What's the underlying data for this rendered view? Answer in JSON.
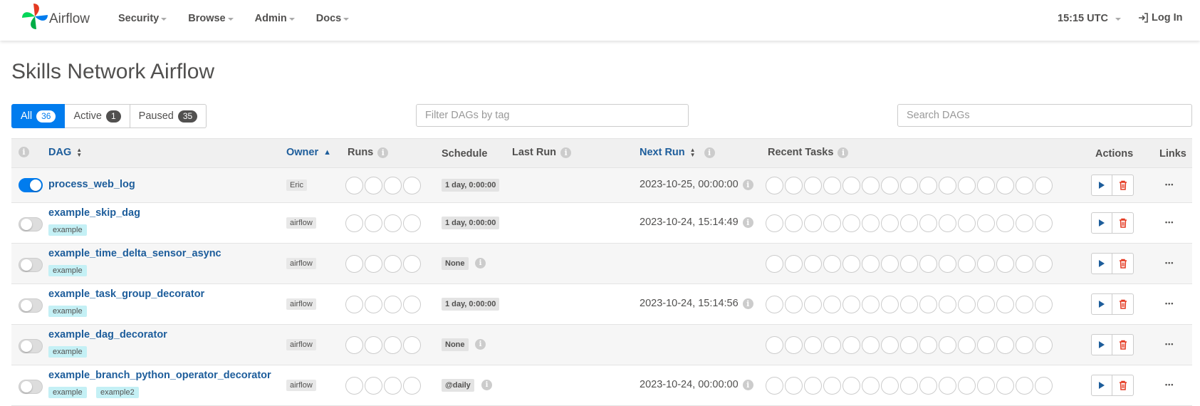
{
  "navbar": {
    "brand": "Airflow",
    "menu": [
      {
        "label": "Security"
      },
      {
        "label": "Browse"
      },
      {
        "label": "Admin"
      },
      {
        "label": "Docs"
      }
    ],
    "clock": "15:15 UTC",
    "login": "Log In"
  },
  "page": {
    "title": "Skills Network Airflow"
  },
  "status_filter": {
    "all": {
      "label": "All",
      "count": "36"
    },
    "active": {
      "label": "Active",
      "count": "1"
    },
    "paused": {
      "label": "Paused",
      "count": "35"
    }
  },
  "filters": {
    "tag_placeholder": "Filter DAGs by tag",
    "search_placeholder": "Search DAGs"
  },
  "table": {
    "headers": {
      "dag": "DAG",
      "owner": "Owner",
      "runs": "Runs",
      "schedule": "Schedule",
      "last_run": "Last Run",
      "next_run": "Next Run",
      "recent_tasks": "Recent Tasks",
      "actions": "Actions",
      "links": "Links"
    },
    "rows": [
      {
        "dag_id": "process_web_log",
        "tags": [],
        "owner": "Eric",
        "schedule": "1 day, 0:00:00",
        "next_run": "2023-10-25, 00:00:00",
        "active": true
      },
      {
        "dag_id": "example_skip_dag",
        "tags": [
          "example"
        ],
        "owner": "airflow",
        "schedule": "1 day, 0:00:00",
        "next_run": "2023-10-24, 15:14:49",
        "active": false
      },
      {
        "dag_id": "example_time_delta_sensor_async",
        "tags": [
          "example"
        ],
        "owner": "airflow",
        "schedule": "None",
        "next_run": "",
        "active": false
      },
      {
        "dag_id": "example_task_group_decorator",
        "tags": [
          "example"
        ],
        "owner": "airflow",
        "schedule": "1 day, 0:00:00",
        "next_run": "2023-10-24, 15:14:56",
        "active": false
      },
      {
        "dag_id": "example_dag_decorator",
        "tags": [
          "example"
        ],
        "owner": "airflow",
        "schedule": "None",
        "next_run": "",
        "active": false
      },
      {
        "dag_id": "example_branch_python_operator_decorator",
        "tags": [
          "example",
          "example2"
        ],
        "owner": "airflow",
        "schedule": "@daily",
        "next_run": "2023-10-24, 00:00:00",
        "active": false
      }
    ]
  },
  "colors": {
    "primary": "#017cee",
    "link": "#1d5d9b",
    "tag_bg": "#c4f0f5",
    "delete": "#e43921"
  },
  "icons": {
    "trigger": "play-icon",
    "delete": "trash-icon",
    "links": "ellipsis-icon",
    "login": "login-icon",
    "info": "info-icon"
  }
}
